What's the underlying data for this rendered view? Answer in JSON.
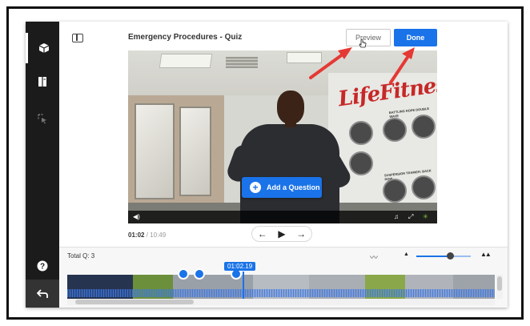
{
  "header": {
    "quiz_title": "Emergency Procedures - Quiz",
    "preview_label": "Preview",
    "done_label": "Done"
  },
  "sidebar": {
    "items": [
      {
        "icon": "cube-icon",
        "active": true
      },
      {
        "icon": "book-icon",
        "active": false
      },
      {
        "icon": "cursor-select-icon",
        "active": false
      }
    ],
    "bottom": [
      {
        "icon": "help-icon"
      },
      {
        "icon": "back-icon"
      }
    ]
  },
  "video": {
    "brand_text": "LifeFitness",
    "wall_text_1": "BATTLING ROPE DOUBLE WAVE",
    "wall_text_2": "SUSPENSION TRAINER: BACK ROW",
    "add_question_label": "Add a Question"
  },
  "playback": {
    "current_time": "01:02",
    "total_time": "/ 10:49",
    "prev_label": "←",
    "play_label": "▶",
    "next_label": "→"
  },
  "timeline": {
    "total_questions_label": "Total Q: 3",
    "playhead_time": "01:02.19",
    "question_count": 3
  },
  "colors": {
    "accent": "#1a73e8",
    "sidebar_bg": "#1b1b1b",
    "annotation_arrow": "#e53935"
  }
}
